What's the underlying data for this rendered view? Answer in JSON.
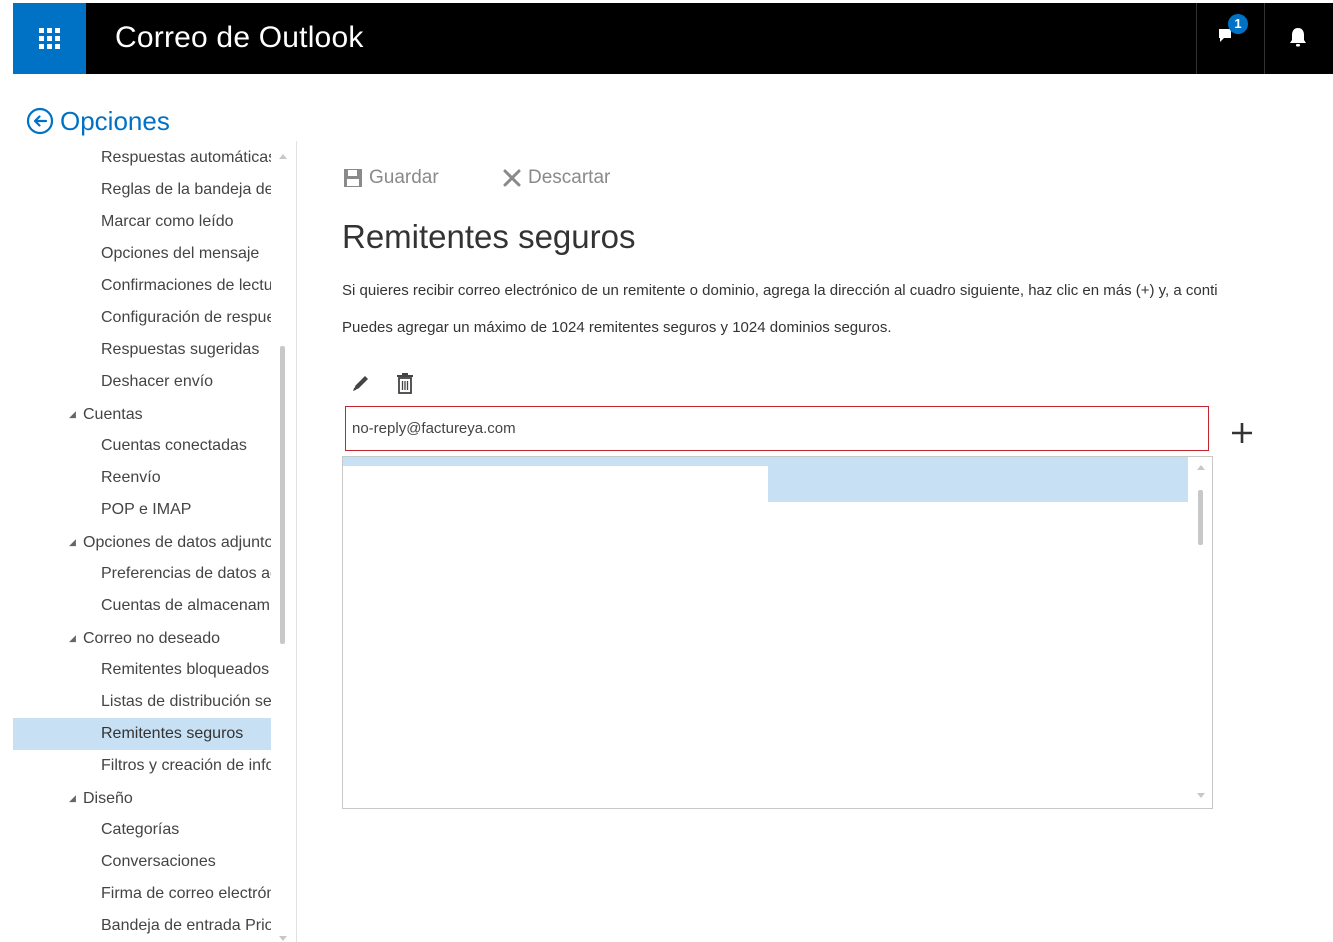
{
  "app": {
    "title": "Correo de Outlook",
    "notification_count": "1",
    "accent_color": "#0072c6"
  },
  "options": {
    "title": "Opciones"
  },
  "nav": {
    "items": [
      {
        "label": "Respuestas automáticas",
        "level": 2
      },
      {
        "label": "Reglas de la bandeja de entrada",
        "level": 2
      },
      {
        "label": "Marcar como leído",
        "level": 2
      },
      {
        "label": "Opciones del mensaje",
        "level": 2
      },
      {
        "label": "Confirmaciones de lectura",
        "level": 2
      },
      {
        "label": "Configuración de respuesta",
        "level": 2
      },
      {
        "label": "Respuestas sugeridas",
        "level": 2
      },
      {
        "label": "Deshacer envío",
        "level": 2
      },
      {
        "label": "Cuentas",
        "level": 1
      },
      {
        "label": "Cuentas conectadas",
        "level": 2
      },
      {
        "label": "Reenvío",
        "level": 2
      },
      {
        "label": "POP e IMAP",
        "level": 2
      },
      {
        "label": "Opciones de datos adjuntos",
        "level": 1
      },
      {
        "label": "Preferencias de datos adjuntos",
        "level": 2
      },
      {
        "label": "Cuentas de almacenamiento",
        "level": 2
      },
      {
        "label": "Correo no deseado",
        "level": 1
      },
      {
        "label": "Remitentes bloqueados",
        "level": 2
      },
      {
        "label": "Listas de distribución seguras",
        "level": 2
      },
      {
        "label": "Remitentes seguros",
        "level": 2,
        "active": true
      },
      {
        "label": "Filtros y creación de informes",
        "level": 2
      },
      {
        "label": "Diseño",
        "level": 1
      },
      {
        "label": "Categorías",
        "level": 2
      },
      {
        "label": "Conversaciones",
        "level": 2
      },
      {
        "label": "Firma de correo electrónico",
        "level": 2
      },
      {
        "label": "Bandeja de entrada Prioritarios",
        "level": 2
      }
    ]
  },
  "toolbar": {
    "save_label": "Guardar",
    "discard_label": "Descartar"
  },
  "page": {
    "title": "Remitentes seguros",
    "description_1": "Si quieres recibir correo electrónico de un remitente o dominio, agrega la dirección al cuadro siguiente, haz clic en más (+) y, a conti",
    "description_2": "Puedes agregar un máximo de 1024 remitentes seguros y 1024 dominios seguros."
  },
  "sender_input": {
    "value": "no-reply@factureya.com"
  },
  "colors": {
    "selection": "#c7e0f4",
    "input_border": "#c4262e",
    "top_bar": "#000000"
  },
  "icons": [
    "app-launcher-icon",
    "back-arrow-icon",
    "chat-icon",
    "bell-icon",
    "save-icon",
    "close-icon",
    "pencil-icon",
    "trash-icon",
    "plus-icon"
  ]
}
